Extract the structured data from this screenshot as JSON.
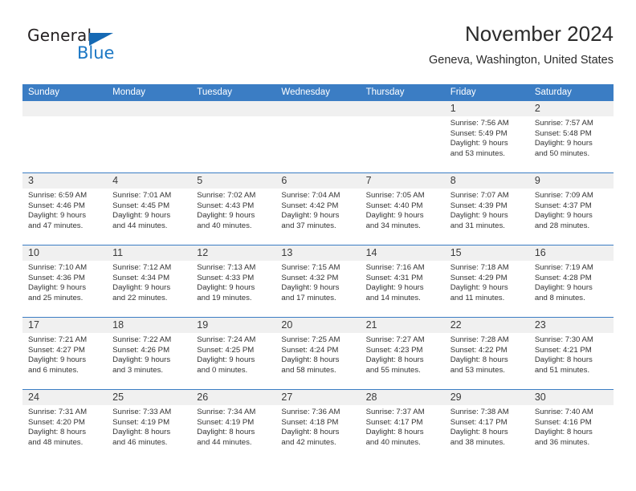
{
  "brand": {
    "name_part1": "General",
    "name_part2": "Blue",
    "accent_color": "#1b77c4"
  },
  "header": {
    "title": "November 2024",
    "subtitle": "Geneva, Washington, United States"
  },
  "theme": {
    "header_row_bg": "#3b7dc4",
    "day_strip_bg": "#f0f0f0",
    "week_divider": "#3b7dc4"
  },
  "weekdays": [
    "Sunday",
    "Monday",
    "Tuesday",
    "Wednesday",
    "Thursday",
    "Friday",
    "Saturday"
  ],
  "weeks": [
    [
      {
        "day": "",
        "empty": true
      },
      {
        "day": "",
        "empty": true
      },
      {
        "day": "",
        "empty": true
      },
      {
        "day": "",
        "empty": true
      },
      {
        "day": "",
        "empty": true
      },
      {
        "day": "1",
        "sunrise": "Sunrise: 7:56 AM",
        "sunset": "Sunset: 5:49 PM",
        "daylight1": "Daylight: 9 hours",
        "daylight2": "and 53 minutes."
      },
      {
        "day": "2",
        "sunrise": "Sunrise: 7:57 AM",
        "sunset": "Sunset: 5:48 PM",
        "daylight1": "Daylight: 9 hours",
        "daylight2": "and 50 minutes."
      }
    ],
    [
      {
        "day": "3",
        "sunrise": "Sunrise: 6:59 AM",
        "sunset": "Sunset: 4:46 PM",
        "daylight1": "Daylight: 9 hours",
        "daylight2": "and 47 minutes."
      },
      {
        "day": "4",
        "sunrise": "Sunrise: 7:01 AM",
        "sunset": "Sunset: 4:45 PM",
        "daylight1": "Daylight: 9 hours",
        "daylight2": "and 44 minutes."
      },
      {
        "day": "5",
        "sunrise": "Sunrise: 7:02 AM",
        "sunset": "Sunset: 4:43 PM",
        "daylight1": "Daylight: 9 hours",
        "daylight2": "and 40 minutes."
      },
      {
        "day": "6",
        "sunrise": "Sunrise: 7:04 AM",
        "sunset": "Sunset: 4:42 PM",
        "daylight1": "Daylight: 9 hours",
        "daylight2": "and 37 minutes."
      },
      {
        "day": "7",
        "sunrise": "Sunrise: 7:05 AM",
        "sunset": "Sunset: 4:40 PM",
        "daylight1": "Daylight: 9 hours",
        "daylight2": "and 34 minutes."
      },
      {
        "day": "8",
        "sunrise": "Sunrise: 7:07 AM",
        "sunset": "Sunset: 4:39 PM",
        "daylight1": "Daylight: 9 hours",
        "daylight2": "and 31 minutes."
      },
      {
        "day": "9",
        "sunrise": "Sunrise: 7:09 AM",
        "sunset": "Sunset: 4:37 PM",
        "daylight1": "Daylight: 9 hours",
        "daylight2": "and 28 minutes."
      }
    ],
    [
      {
        "day": "10",
        "sunrise": "Sunrise: 7:10 AM",
        "sunset": "Sunset: 4:36 PM",
        "daylight1": "Daylight: 9 hours",
        "daylight2": "and 25 minutes."
      },
      {
        "day": "11",
        "sunrise": "Sunrise: 7:12 AM",
        "sunset": "Sunset: 4:34 PM",
        "daylight1": "Daylight: 9 hours",
        "daylight2": "and 22 minutes."
      },
      {
        "day": "12",
        "sunrise": "Sunrise: 7:13 AM",
        "sunset": "Sunset: 4:33 PM",
        "daylight1": "Daylight: 9 hours",
        "daylight2": "and 19 minutes."
      },
      {
        "day": "13",
        "sunrise": "Sunrise: 7:15 AM",
        "sunset": "Sunset: 4:32 PM",
        "daylight1": "Daylight: 9 hours",
        "daylight2": "and 17 minutes."
      },
      {
        "day": "14",
        "sunrise": "Sunrise: 7:16 AM",
        "sunset": "Sunset: 4:31 PM",
        "daylight1": "Daylight: 9 hours",
        "daylight2": "and 14 minutes."
      },
      {
        "day": "15",
        "sunrise": "Sunrise: 7:18 AM",
        "sunset": "Sunset: 4:29 PM",
        "daylight1": "Daylight: 9 hours",
        "daylight2": "and 11 minutes."
      },
      {
        "day": "16",
        "sunrise": "Sunrise: 7:19 AM",
        "sunset": "Sunset: 4:28 PM",
        "daylight1": "Daylight: 9 hours",
        "daylight2": "and 8 minutes."
      }
    ],
    [
      {
        "day": "17",
        "sunrise": "Sunrise: 7:21 AM",
        "sunset": "Sunset: 4:27 PM",
        "daylight1": "Daylight: 9 hours",
        "daylight2": "and 6 minutes."
      },
      {
        "day": "18",
        "sunrise": "Sunrise: 7:22 AM",
        "sunset": "Sunset: 4:26 PM",
        "daylight1": "Daylight: 9 hours",
        "daylight2": "and 3 minutes."
      },
      {
        "day": "19",
        "sunrise": "Sunrise: 7:24 AM",
        "sunset": "Sunset: 4:25 PM",
        "daylight1": "Daylight: 9 hours",
        "daylight2": "and 0 minutes."
      },
      {
        "day": "20",
        "sunrise": "Sunrise: 7:25 AM",
        "sunset": "Sunset: 4:24 PM",
        "daylight1": "Daylight: 8 hours",
        "daylight2": "and 58 minutes."
      },
      {
        "day": "21",
        "sunrise": "Sunrise: 7:27 AM",
        "sunset": "Sunset: 4:23 PM",
        "daylight1": "Daylight: 8 hours",
        "daylight2": "and 55 minutes."
      },
      {
        "day": "22",
        "sunrise": "Sunrise: 7:28 AM",
        "sunset": "Sunset: 4:22 PM",
        "daylight1": "Daylight: 8 hours",
        "daylight2": "and 53 minutes."
      },
      {
        "day": "23",
        "sunrise": "Sunrise: 7:30 AM",
        "sunset": "Sunset: 4:21 PM",
        "daylight1": "Daylight: 8 hours",
        "daylight2": "and 51 minutes."
      }
    ],
    [
      {
        "day": "24",
        "sunrise": "Sunrise: 7:31 AM",
        "sunset": "Sunset: 4:20 PM",
        "daylight1": "Daylight: 8 hours",
        "daylight2": "and 48 minutes."
      },
      {
        "day": "25",
        "sunrise": "Sunrise: 7:33 AM",
        "sunset": "Sunset: 4:19 PM",
        "daylight1": "Daylight: 8 hours",
        "daylight2": "and 46 minutes."
      },
      {
        "day": "26",
        "sunrise": "Sunrise: 7:34 AM",
        "sunset": "Sunset: 4:19 PM",
        "daylight1": "Daylight: 8 hours",
        "daylight2": "and 44 minutes."
      },
      {
        "day": "27",
        "sunrise": "Sunrise: 7:36 AM",
        "sunset": "Sunset: 4:18 PM",
        "daylight1": "Daylight: 8 hours",
        "daylight2": "and 42 minutes."
      },
      {
        "day": "28",
        "sunrise": "Sunrise: 7:37 AM",
        "sunset": "Sunset: 4:17 PM",
        "daylight1": "Daylight: 8 hours",
        "daylight2": "and 40 minutes."
      },
      {
        "day": "29",
        "sunrise": "Sunrise: 7:38 AM",
        "sunset": "Sunset: 4:17 PM",
        "daylight1": "Daylight: 8 hours",
        "daylight2": "and 38 minutes."
      },
      {
        "day": "30",
        "sunrise": "Sunrise: 7:40 AM",
        "sunset": "Sunset: 4:16 PM",
        "daylight1": "Daylight: 8 hours",
        "daylight2": "and 36 minutes."
      }
    ]
  ]
}
